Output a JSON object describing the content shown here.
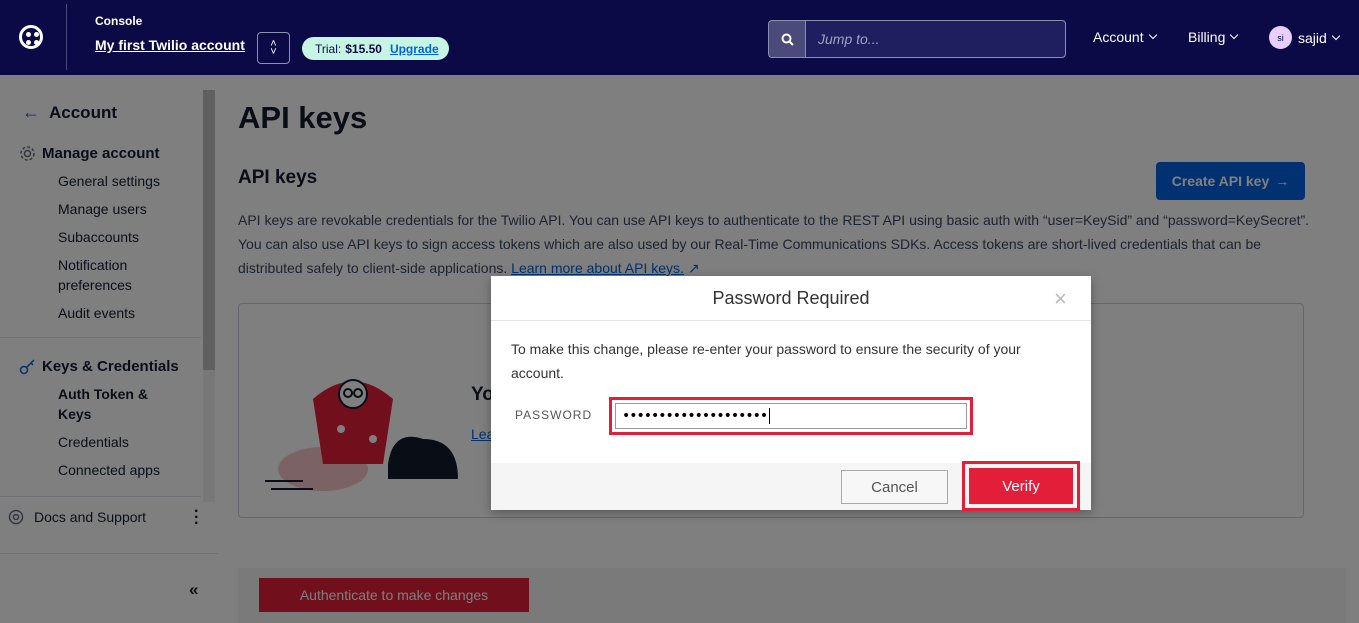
{
  "topbar": {
    "console_label": "Console",
    "account_name": "My first Twilio account",
    "trial_label": "Trial:",
    "trial_amount": "$15.50",
    "upgrade_label": "Upgrade",
    "search_placeholder": "Jump to...",
    "account_menu": "Account",
    "billing_menu": "Billing",
    "avatar_initials": "si",
    "user_name": "sajid"
  },
  "sidebar": {
    "back_label": "Account",
    "manage_section": "Manage account",
    "manage_items": [
      "General settings",
      "Manage users",
      "Subaccounts",
      "Notification preferences",
      "Audit events"
    ],
    "keys_section": "Keys & Credentials",
    "keys_items": [
      "Auth Token & Keys",
      "Credentials",
      "Connected apps"
    ],
    "docs_label": "Docs and Support",
    "collapse_label": "«"
  },
  "main": {
    "page_title": "API keys",
    "section_title": "API keys",
    "create_button": "Create API key",
    "description": "API keys are revokable credentials for the Twilio API. You can use API keys to authenticate to the REST API using basic auth with “user=KeySid” and “password=KeySecret”. You can also use API keys to sign access tokens which are also used by our Real-Time Communications SDKs. Access tokens are short-lived credentials that can be distributed safely to client-side applications.",
    "learn_more_link": "Learn more about API keys.",
    "card_heading": "Yo",
    "card_link": "Lea",
    "auth_button": "Authenticate to make changes"
  },
  "modal": {
    "title": "Password Required",
    "close_symbol": "×",
    "message": "To make this change, please re-enter your password to ensure the security of your account.",
    "password_label": "PASSWORD",
    "password_value": "••••••••••••••••••••",
    "cancel_button": "Cancel",
    "verify_button": "Verify"
  },
  "colors": {
    "header_bg": "#0b0a47",
    "primary_blue": "#0263e0",
    "danger_red": "#e31e38",
    "trial_badge_bg": "#c7f5e3"
  }
}
